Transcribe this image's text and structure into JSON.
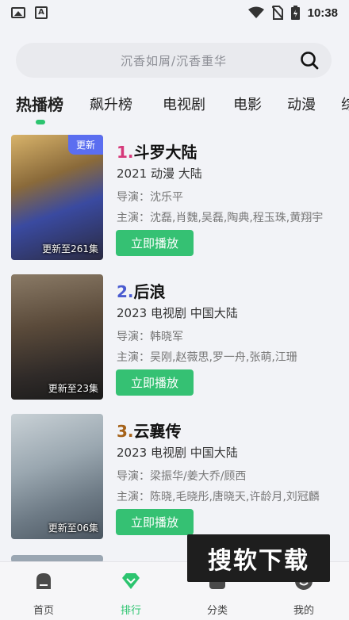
{
  "status_bar": {
    "time": "10:38"
  },
  "search": {
    "placeholder": "沉香如屑/沉香重华"
  },
  "tabs": [
    {
      "label": "热播榜",
      "active": true
    },
    {
      "label": "飙升榜"
    },
    {
      "label": "电视剧"
    },
    {
      "label": "电影"
    },
    {
      "label": "动漫"
    },
    {
      "label": "综"
    }
  ],
  "items": [
    {
      "rank": "1.",
      "rank_color": "#d6397a",
      "title": "斗罗大陆",
      "meta": "2021  动漫  大陆",
      "director": "导演：沈乐平",
      "cast": "主演：沈磊,肖魏,吴磊,陶典,程玉珠,黄翔宇",
      "poster_caption": "更新至261集",
      "poster_tag": "更新",
      "play_label": "立即播放"
    },
    {
      "rank": "2.",
      "rank_color": "#4a5bd0",
      "title": "后浪",
      "meta": "2023  电视剧  中国大陆",
      "director": "导演：韩晓军",
      "cast": "主演：吴刚,赵薇思,罗一舟,张萌,江珊",
      "poster_caption": "更新至23集",
      "play_label": "立即播放"
    },
    {
      "rank": "3.",
      "rank_color": "#a5621a",
      "title": "云襄传",
      "meta": "2023  电视剧  中国大陆",
      "director": "导演：梁振华/姜大乔/顾西",
      "cast": "主演：陈晓,毛晓彤,唐晓天,许龄月,刘冠麟",
      "poster_caption": "更新至06集",
      "play_label": "立即播放"
    }
  ],
  "watermark": "搜软下载",
  "nav": [
    {
      "label": "首页"
    },
    {
      "label": "排行",
      "active": true
    },
    {
      "label": "分类"
    },
    {
      "label": "我的"
    }
  ],
  "colors": {
    "accent": "#2cc46f",
    "button": "#35c173",
    "tag": "#5b6ef0"
  }
}
